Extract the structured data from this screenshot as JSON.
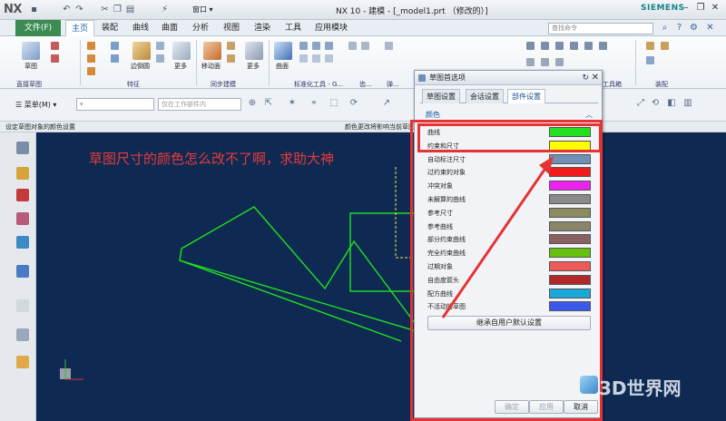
{
  "app": {
    "logo": "NX",
    "title": "NX 10 - 建模 - [_model1.prt （修改的）]",
    "window_menu": "窗口",
    "brand": "SIEMENS"
  },
  "ribbon_tabs": {
    "file": "文件(F)",
    "items": [
      "主页",
      "装配",
      "曲线",
      "曲面",
      "分析",
      "视图",
      "渲染",
      "工具",
      "应用模块"
    ],
    "active": "主页",
    "search_placeholder": "查找命令"
  },
  "ribbon": {
    "buttons": [
      "草图",
      "边倒圆",
      "更多",
      "移动面",
      "更多",
      "曲面"
    ],
    "groups": [
      "直接草图",
      "特征",
      "同步建模",
      "标准化工具 - G...",
      "齿...",
      "弹...",
      "工具箱",
      "装配"
    ]
  },
  "toolbar2": {
    "menu_label": "菜单(M)",
    "selection_filter": "仅在工作部件内"
  },
  "status": {
    "left": "设定草图对象的颜色设置",
    "right": "颜色更改将影响当前草图"
  },
  "annotation": "草图尺寸的颜色怎么改不了啊，求助大神",
  "dialog": {
    "title": "草图首选项",
    "tabs": [
      "草图设置",
      "会话设置",
      "部件设置"
    ],
    "active_tab": "部件设置",
    "section": "颜色",
    "rows": [
      {
        "label": "曲线",
        "color": "#22e01e"
      },
      {
        "label": "约束和尺寸",
        "color": "#ffff00"
      },
      {
        "label": "自动标注尺寸",
        "color": "#7090b8"
      },
      {
        "label": "过约束的对象",
        "color": "#ee1c1c"
      },
      {
        "label": "冲突对象",
        "color": "#ee22ee"
      },
      {
        "label": "未解算的曲线",
        "color": "#8a8a8a"
      },
      {
        "label": "参考尺寸",
        "color": "#8c8a60"
      },
      {
        "label": "参考曲线",
        "color": "#8a8468"
      },
      {
        "label": "部分约束曲线",
        "color": "#8a6060"
      },
      {
        "label": "完全约束曲线",
        "color": "#66c00e"
      },
      {
        "label": "过期对象",
        "color": "#ee5a5a"
      },
      {
        "label": "自由度箭头",
        "color": "#b02828"
      },
      {
        "label": "配方曲线",
        "color": "#1aa8d8"
      },
      {
        "label": "不活动的草图",
        "color": "#3a58ee"
      }
    ],
    "inherit_button": "继承自用户默认设置",
    "ok": "确定",
    "apply": "应用",
    "cancel": "取消"
  },
  "watermark": "3D世界网",
  "colors": {
    "viewport_bg": "#0e2a52",
    "sketch_curve": "#22e01e",
    "highlight": "#e53333",
    "annotation": "#e83a3a"
  }
}
